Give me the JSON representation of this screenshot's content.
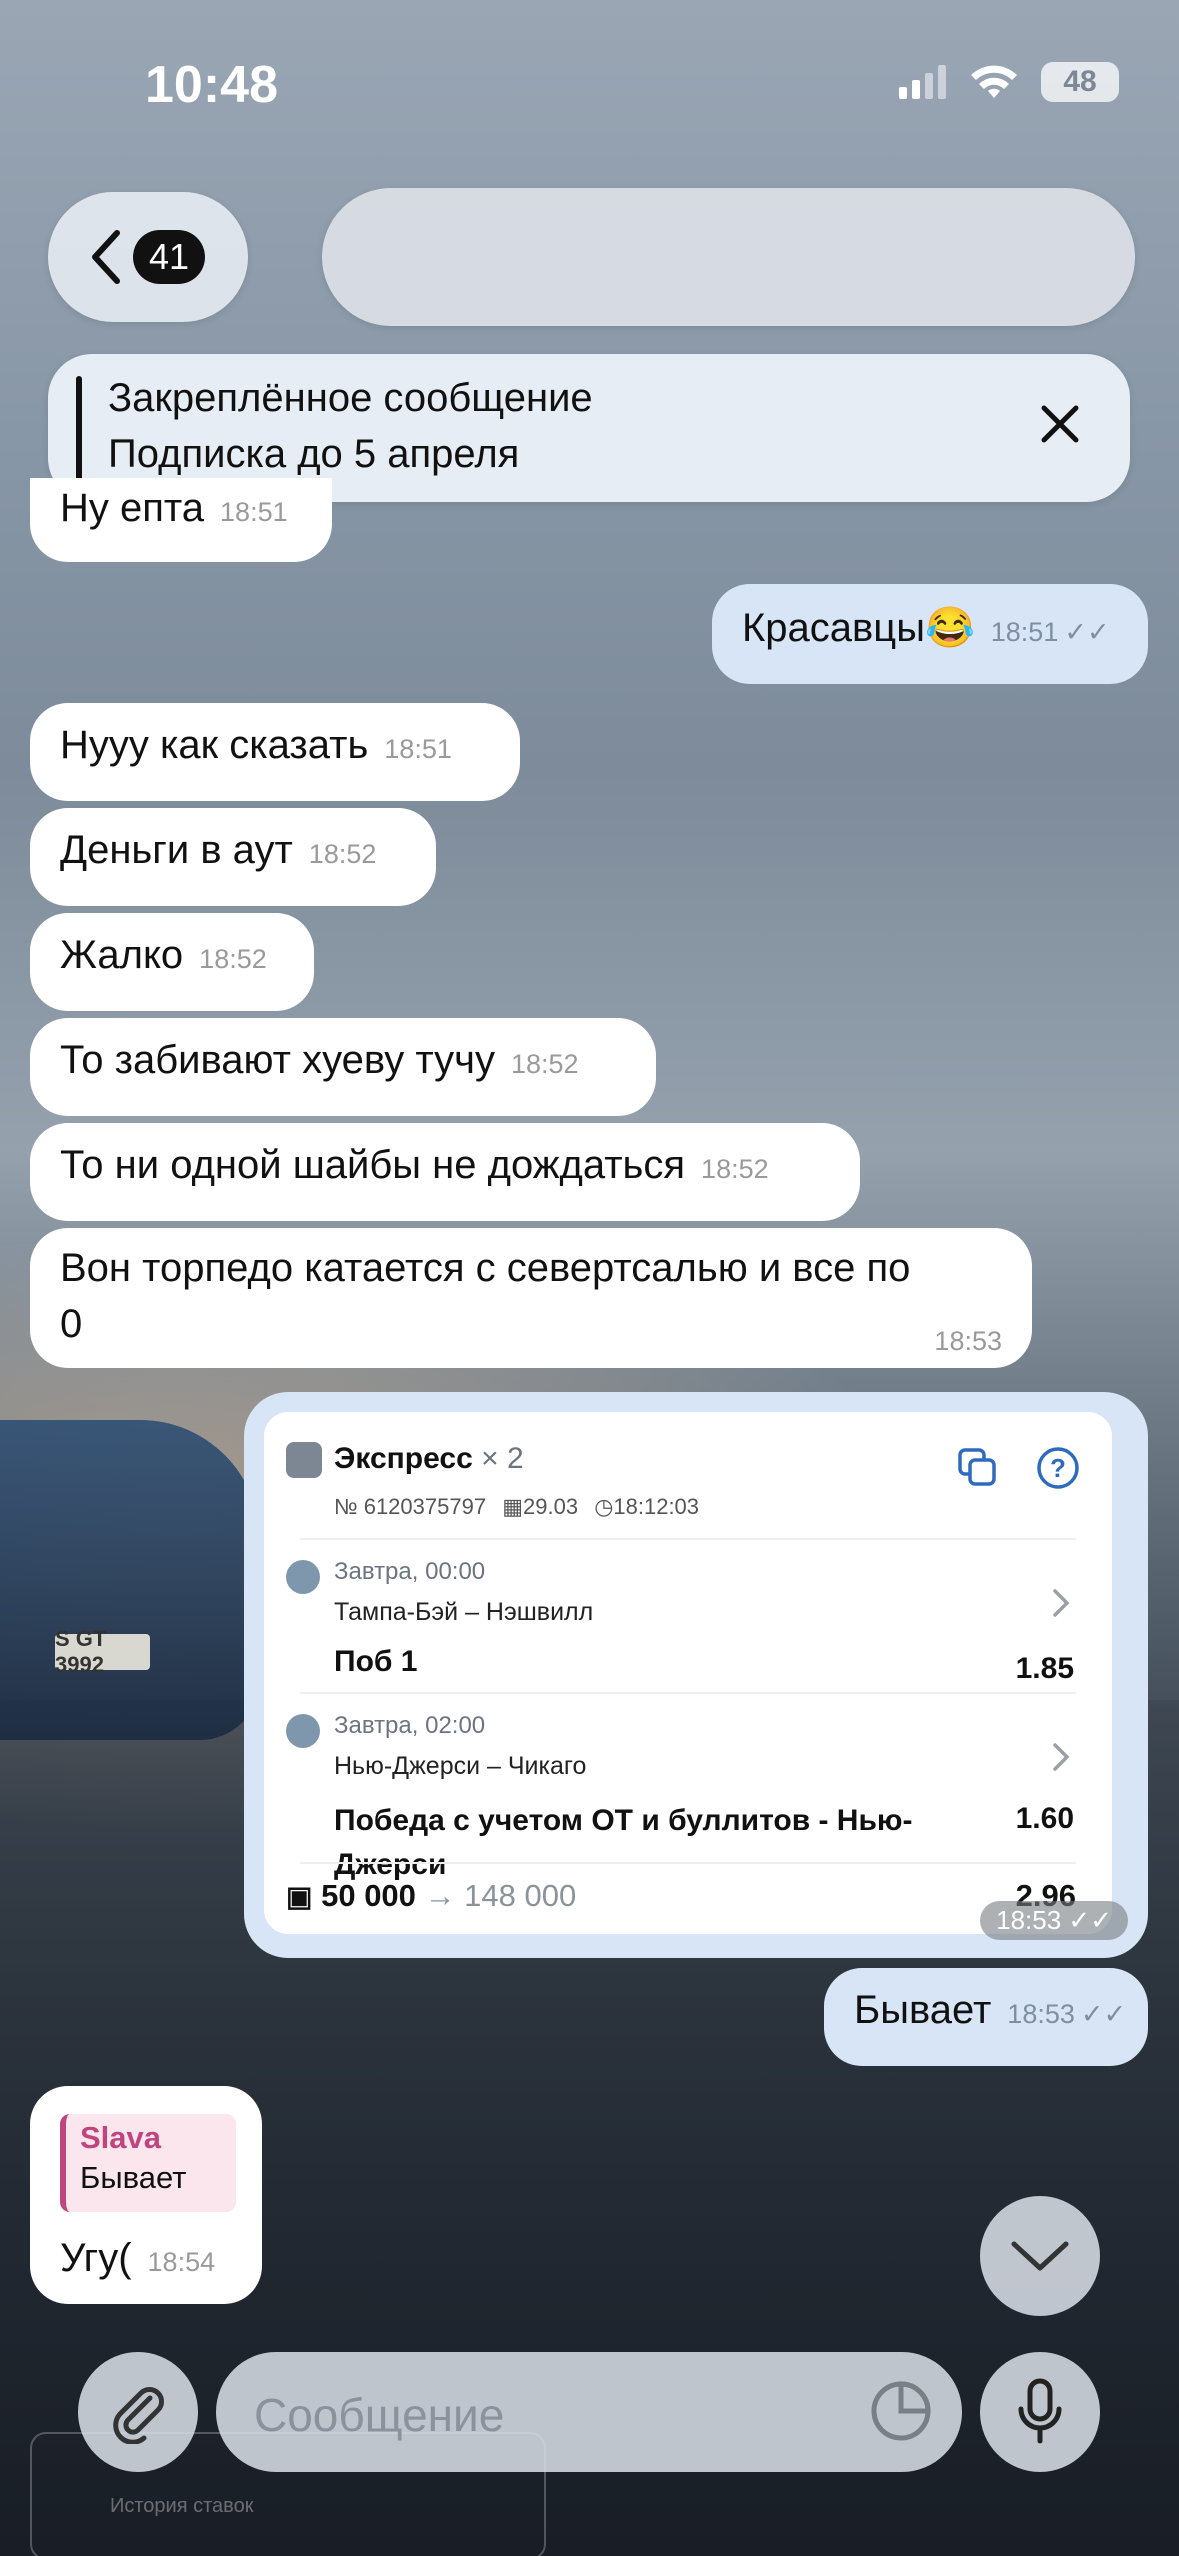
{
  "status": {
    "time": "10:48",
    "battery": "48"
  },
  "header": {
    "unread_count": "41"
  },
  "pinned": {
    "title": "Закреплённое сообщение",
    "text": "Подписка до 5 апреля"
  },
  "messages": [
    {
      "text": "Ну епта",
      "time": "18:51"
    },
    {
      "text": "Красавцы😂",
      "time": "18:51"
    },
    {
      "text": "Нууу как сказать",
      "time": "18:51"
    },
    {
      "text": "Деньги в аут",
      "time": "18:52"
    },
    {
      "text": "Жалко",
      "time": "18:52"
    },
    {
      "text": "То забивают хуеву тучу",
      "time": "18:52"
    },
    {
      "text": "То ни одной шайбы не дождаться",
      "time": "18:52"
    },
    {
      "text": "Вон торпедо катается с севертсалью и все по 0",
      "time": "18:53"
    },
    {
      "text": "Бывает",
      "time": "18:53"
    },
    {
      "text": "Угу(",
      "time": "18:54"
    }
  ],
  "bet": {
    "title": "Экспресс",
    "mult": "× 2",
    "number": "№ 6120375797",
    "date": "29.03",
    "clock": "18:12:03",
    "events": [
      {
        "when": "Завтра, 00:00",
        "match": "Тампа-Бэй – Нэшвилл",
        "pick": "Поб 1",
        "odd": "1.85"
      },
      {
        "when": "Завтра, 02:00",
        "match": "Нью-Джерси – Чикаго",
        "pick": "Победа с учетом ОТ и буллитов - Нью-Джерси",
        "odd": "1.60"
      }
    ],
    "stake": "50 000",
    "arrow": "→",
    "payout": "148 000",
    "total_odd": "2.96",
    "time": "18:53"
  },
  "reply": {
    "author": "Slava",
    "quote": "Бывает"
  },
  "composer": {
    "placeholder": "Сообщение"
  },
  "background_card": {
    "label": "История ставок"
  },
  "colors": {
    "outgoing": "#d7e5f6",
    "incoming": "#ffffff",
    "reply_accent": "#c0457e"
  }
}
